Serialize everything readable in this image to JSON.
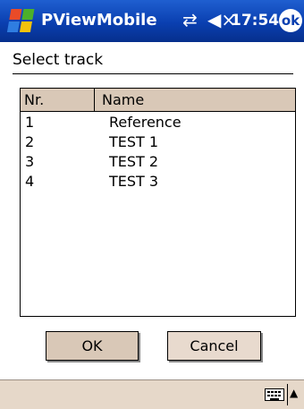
{
  "titlebar": {
    "app_title": "PViewMobile",
    "time": "17:54",
    "ok_label": "ok"
  },
  "dialog": {
    "heading": "Select track",
    "columns": [
      "Nr.",
      "Name"
    ],
    "rows": [
      {
        "nr": "1",
        "name": "Reference"
      },
      {
        "nr": "2",
        "name": "TEST 1"
      },
      {
        "nr": "3",
        "name": "TEST 2"
      },
      {
        "nr": "4",
        "name": "TEST 3"
      }
    ],
    "ok_button": "OK",
    "cancel_button": "Cancel"
  },
  "icons": {
    "start": "windows-start-icon",
    "connectivity": "connectivity-icon",
    "volume": "volume-muted-icon",
    "keyboard": "keyboard-icon",
    "sip_arrow": "arrow-up-icon"
  }
}
